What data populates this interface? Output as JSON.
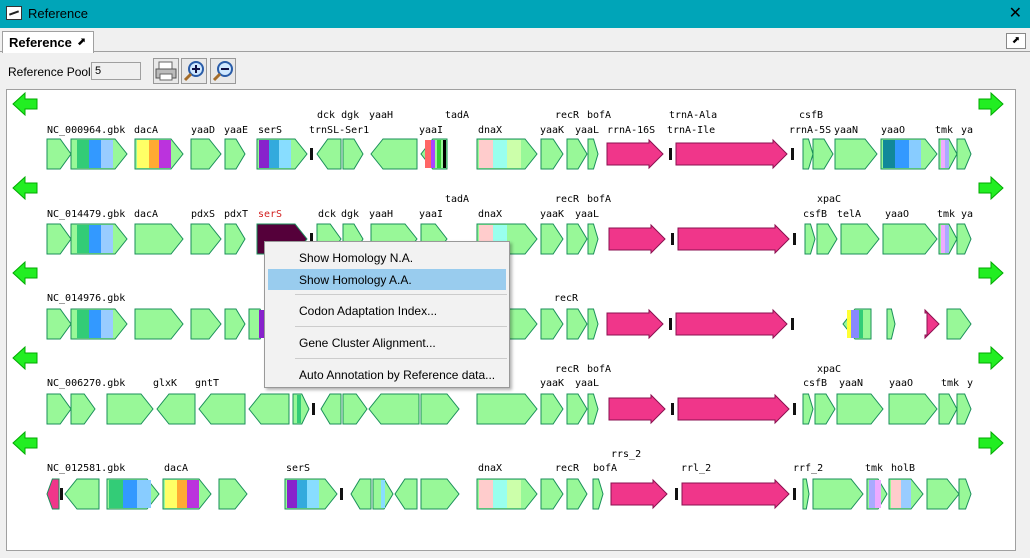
{
  "window": {
    "title": "Reference",
    "close_icon": "close-icon"
  },
  "tab": {
    "label": "Reference"
  },
  "toolbar": {
    "pool_label": "Reference Pool:",
    "pool_value": "5",
    "buttons": [
      "print-icon",
      "zoom-in-icon",
      "zoom-out-icon"
    ]
  },
  "colors": {
    "gene_green": "#98f898",
    "rrna_pink": "#f0368a",
    "nav_arrow": "#22ee22",
    "selected_gene": "#55003a",
    "highlight_label": "#d21e1e",
    "menu_highlight": "#99ccee"
  },
  "rows": [
    {
      "accession": "NC_000964.gbk",
      "labels": [
        "dacA",
        "yaaD",
        "yaaE",
        "serS",
        "trnSL-Ser1",
        "yaaI",
        "dnaX",
        "yaaK",
        "yaaL",
        "rrnA-16S",
        "trnA-Ile",
        "rrnA-5S",
        "yaaN",
        "yaaO",
        "tmk",
        "ya"
      ],
      "top_labels": [
        "dck dgk",
        "yaaH",
        "tadA",
        "recR",
        "bofA",
        "trnA-Ala",
        "csfB"
      ]
    },
    {
      "accession": "NC_014479.gbk",
      "labels": [
        "dacA",
        "pdxS",
        "pdxT",
        "serS",
        "dck",
        "dgk",
        "yaaH",
        "yaaI",
        "dnaX",
        "yaaK",
        "yaaL",
        "csfB",
        "telA",
        "yaaO",
        "tmk",
        "ya"
      ],
      "top_labels": [
        "tadA",
        "recR",
        "bofA",
        "xpaC"
      ],
      "highlighted_label": "serS"
    },
    {
      "accession": "NC_014976.gbk",
      "labels": [
        "recR"
      ],
      "top_labels": []
    },
    {
      "accession": "NC_006270.gbk",
      "labels": [
        "glxK",
        "gntT",
        "yaaK",
        "yaaL",
        "csfB",
        "yaaN",
        "yaaO",
        "tmk",
        "y"
      ],
      "top_labels": [
        "recR",
        "bofA",
        "xpaC"
      ]
    },
    {
      "accession": "NC_012581.gbk",
      "labels": [
        "dacA",
        "serS",
        "dnaX",
        "recR",
        "bofA",
        "rrl_2",
        "rrf_2",
        "tmk",
        "holB"
      ],
      "top_labels": [
        "rrs_2"
      ]
    }
  ],
  "context_menu": {
    "items": [
      "Show Homology N.A.",
      "Show Homology A.A.",
      "Codon Adaptation Index...",
      "Gene Cluster Alignment...",
      "Auto Annotation by Reference data..."
    ],
    "highlighted_index": 1
  }
}
